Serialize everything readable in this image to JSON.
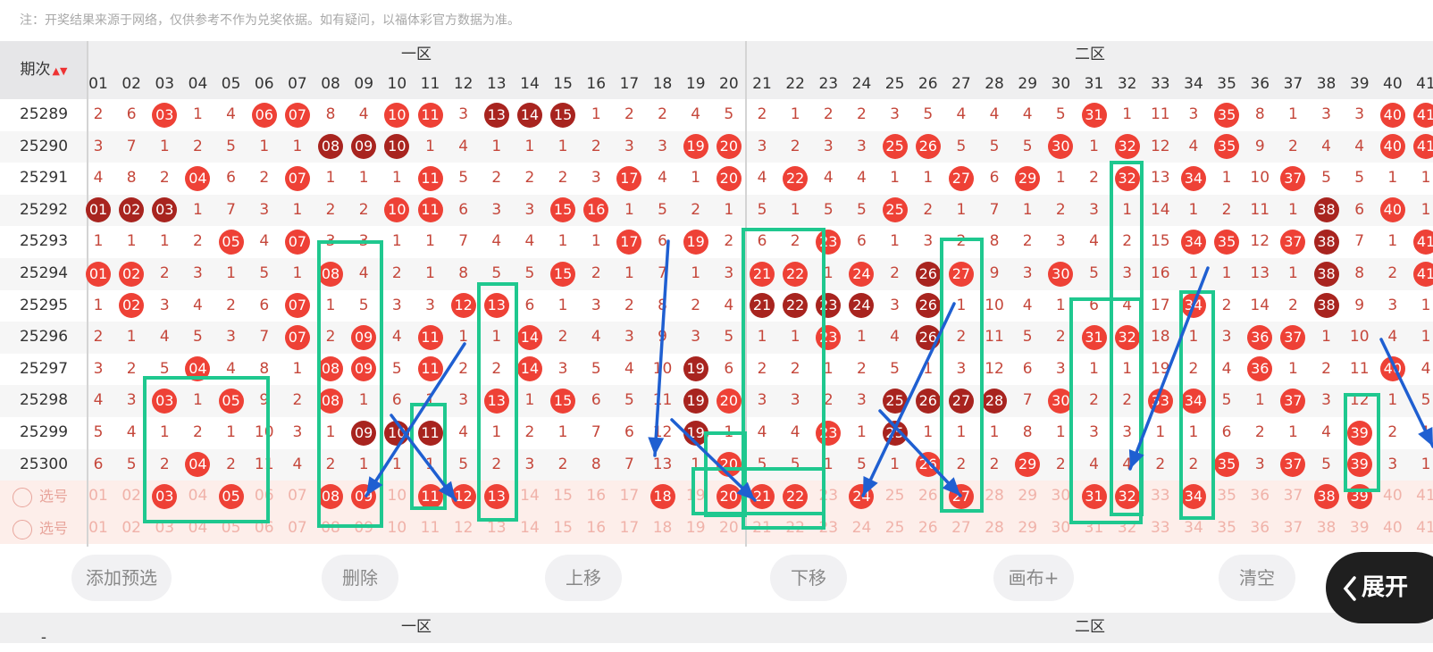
{
  "note": "注：开奖结果来源于网络，仅供参考不作为兑奖依据。如有疑问，以福体彩官方数据为准。",
  "header": {
    "period_label": "期次",
    "zone1_label": "一区",
    "zone2_label": "二区",
    "columns": [
      "01",
      "02",
      "03",
      "04",
      "05",
      "06",
      "07",
      "08",
      "09",
      "10",
      "11",
      "12",
      "13",
      "14",
      "15",
      "16",
      "17",
      "18",
      "19",
      "20",
      "21",
      "22",
      "23",
      "24",
      "25",
      "26",
      "27",
      "28",
      "29",
      "30",
      "31",
      "32",
      "33",
      "34",
      "35",
      "36",
      "37",
      "38",
      "39",
      "40",
      "41"
    ]
  },
  "rows": [
    {
      "period": "25289",
      "cells": [
        "2",
        "6",
        "03",
        "1",
        "4",
        "06",
        "07",
        "8",
        "4",
        "10",
        "11",
        "3",
        "13",
        "14",
        "15",
        "1",
        "2",
        "2",
        "4",
        "5",
        "2",
        "1",
        "2",
        "2",
        "3",
        "5",
        "4",
        "4",
        "4",
        "5",
        "31",
        "1",
        "11",
        "3",
        "35",
        "8",
        "1",
        "3",
        "3",
        "40",
        "41"
      ],
      "red": [
        2,
        5,
        6,
        9,
        10,
        30,
        34,
        39,
        40
      ],
      "dark": [
        12,
        13,
        14
      ]
    },
    {
      "period": "25290",
      "cells": [
        "3",
        "7",
        "1",
        "2",
        "5",
        "1",
        "1",
        "08",
        "09",
        "10",
        "1",
        "4",
        "1",
        "1",
        "1",
        "2",
        "3",
        "3",
        "19",
        "20",
        "3",
        "2",
        "3",
        "3",
        "25",
        "26",
        "5",
        "5",
        "5",
        "30",
        "1",
        "32",
        "12",
        "4",
        "35",
        "9",
        "2",
        "4",
        "4",
        "40",
        "41"
      ],
      "red": [
        18,
        19,
        24,
        25,
        29,
        31,
        34,
        39,
        40
      ],
      "dark": [
        7,
        8,
        9
      ]
    },
    {
      "period": "25291",
      "cells": [
        "4",
        "8",
        "2",
        "04",
        "6",
        "2",
        "07",
        "1",
        "1",
        "1",
        "11",
        "5",
        "2",
        "2",
        "2",
        "3",
        "17",
        "4",
        "1",
        "20",
        "4",
        "22",
        "4",
        "4",
        "1",
        "1",
        "27",
        "6",
        "29",
        "1",
        "2",
        "32",
        "13",
        "34",
        "1",
        "10",
        "37",
        "5",
        "5",
        "1",
        "1"
      ],
      "red": [
        3,
        6,
        10,
        16,
        19,
        21,
        26,
        28,
        31,
        33,
        36
      ],
      "dark": []
    },
    {
      "period": "25292",
      "cells": [
        "01",
        "02",
        "03",
        "1",
        "7",
        "3",
        "1",
        "2",
        "2",
        "10",
        "11",
        "6",
        "3",
        "3",
        "15",
        "16",
        "1",
        "5",
        "2",
        "1",
        "5",
        "1",
        "5",
        "5",
        "25",
        "2",
        "1",
        "7",
        "1",
        "2",
        "3",
        "1",
        "14",
        "1",
        "2",
        "11",
        "1",
        "38",
        "6",
        "40",
        "1"
      ],
      "red": [
        9,
        10,
        14,
        15,
        24,
        39
      ],
      "dark": [
        0,
        1,
        2,
        37
      ]
    },
    {
      "period": "25293",
      "cells": [
        "1",
        "1",
        "1",
        "2",
        "05",
        "4",
        "07",
        "3",
        "3",
        "1",
        "1",
        "7",
        "4",
        "4",
        "1",
        "1",
        "17",
        "6",
        "19",
        "2",
        "6",
        "2",
        "23",
        "6",
        "1",
        "3",
        "2",
        "8",
        "2",
        "3",
        "4",
        "2",
        "15",
        "34",
        "35",
        "12",
        "37",
        "38",
        "7",
        "1",
        "41"
      ],
      "red": [
        4,
        6,
        16,
        18,
        22,
        33,
        34,
        36,
        40
      ],
      "dark": [
        37
      ]
    },
    {
      "period": "25294",
      "cells": [
        "01",
        "02",
        "2",
        "3",
        "1",
        "5",
        "1",
        "08",
        "4",
        "2",
        "1",
        "8",
        "5",
        "5",
        "15",
        "2",
        "1",
        "7",
        "1",
        "3",
        "21",
        "22",
        "1",
        "24",
        "2",
        "26",
        "27",
        "9",
        "3",
        "30",
        "5",
        "3",
        "16",
        "1",
        "1",
        "13",
        "1",
        "38",
        "8",
        "2",
        "41"
      ],
      "red": [
        0,
        1,
        7,
        14,
        20,
        21,
        23,
        26,
        29,
        40
      ],
      "dark": [
        25,
        37
      ]
    },
    {
      "period": "25295",
      "cells": [
        "1",
        "02",
        "3",
        "4",
        "2",
        "6",
        "07",
        "1",
        "5",
        "3",
        "3",
        "12",
        "13",
        "6",
        "1",
        "3",
        "2",
        "8",
        "2",
        "4",
        "21",
        "22",
        "23",
        "24",
        "3",
        "26",
        "1",
        "10",
        "4",
        "1",
        "6",
        "4",
        "17",
        "34",
        "2",
        "14",
        "2",
        "38",
        "9",
        "3",
        "1"
      ],
      "red": [
        1,
        6,
        11,
        12,
        33
      ],
      "dark": [
        20,
        21,
        22,
        23,
        25,
        37
      ]
    },
    {
      "period": "25296",
      "cells": [
        "2",
        "1",
        "4",
        "5",
        "3",
        "7",
        "07",
        "2",
        "09",
        "4",
        "11",
        "1",
        "1",
        "14",
        "2",
        "4",
        "3",
        "9",
        "3",
        "5",
        "1",
        "1",
        "23",
        "1",
        "4",
        "26",
        "2",
        "11",
        "5",
        "2",
        "31",
        "32",
        "18",
        "1",
        "3",
        "36",
        "37",
        "1",
        "10",
        "4",
        "1"
      ],
      "red": [
        6,
        8,
        10,
        13,
        22,
        30,
        31,
        35,
        36
      ],
      "dark": [
        25
      ]
    },
    {
      "period": "25297",
      "cells": [
        "3",
        "2",
        "5",
        "04",
        "4",
        "8",
        "1",
        "08",
        "09",
        "5",
        "11",
        "2",
        "2",
        "14",
        "3",
        "5",
        "4",
        "10",
        "19",
        "6",
        "2",
        "2",
        "1",
        "2",
        "5",
        "1",
        "3",
        "12",
        "6",
        "3",
        "1",
        "1",
        "19",
        "2",
        "4",
        "36",
        "1",
        "2",
        "11",
        "40",
        "4"
      ],
      "red": [
        3,
        7,
        8,
        10,
        13,
        35,
        39
      ],
      "dark": [
        18
      ]
    },
    {
      "period": "25298",
      "cells": [
        "4",
        "3",
        "03",
        "1",
        "05",
        "9",
        "2",
        "08",
        "1",
        "6",
        "1",
        "3",
        "13",
        "1",
        "15",
        "6",
        "5",
        "11",
        "19",
        "20",
        "3",
        "3",
        "2",
        "3",
        "25",
        "26",
        "27",
        "28",
        "7",
        "30",
        "2",
        "2",
        "33",
        "34",
        "5",
        "1",
        "37",
        "3",
        "12",
        "1",
        "5"
      ],
      "red": [
        2,
        4,
        7,
        12,
        14,
        19,
        29,
        32,
        33,
        36
      ],
      "dark": [
        18,
        24,
        25,
        26,
        27
      ]
    },
    {
      "period": "25299",
      "cells": [
        "5",
        "4",
        "1",
        "2",
        "1",
        "10",
        "3",
        "1",
        "09",
        "10",
        "11",
        "4",
        "1",
        "2",
        "1",
        "7",
        "6",
        "12",
        "19",
        "1",
        "4",
        "4",
        "23",
        "1",
        "25",
        "1",
        "1",
        "1",
        "8",
        "1",
        "3",
        "3",
        "1",
        "1",
        "6",
        "2",
        "1",
        "4",
        "39",
        "2",
        "1"
      ],
      "red": [
        22,
        38
      ],
      "dark": [
        8,
        9,
        10,
        18,
        24
      ]
    },
    {
      "period": "25300",
      "cells": [
        "6",
        "5",
        "2",
        "04",
        "2",
        "11",
        "4",
        "2",
        "1",
        "1",
        "1",
        "5",
        "2",
        "3",
        "2",
        "8",
        "7",
        "13",
        "1",
        "20",
        "5",
        "5",
        "1",
        "5",
        "1",
        "26",
        "2",
        "2",
        "29",
        "2",
        "4",
        "4",
        "2",
        "2",
        "35",
        "3",
        "37",
        "5",
        "39",
        "3",
        "1"
      ],
      "red": [
        3,
        19,
        25,
        28,
        34,
        36,
        38
      ],
      "dark": []
    }
  ],
  "selection_rows": [
    {
      "label": "选号",
      "cells": [
        "01",
        "02",
        "03",
        "04",
        "05",
        "06",
        "07",
        "08",
        "09",
        "10",
        "11",
        "12",
        "13",
        "14",
        "15",
        "16",
        "17",
        "18",
        "19",
        "20",
        "21",
        "22",
        "23",
        "24",
        "25",
        "26",
        "27",
        "28",
        "29",
        "30",
        "31",
        "32",
        "33",
        "34",
        "35",
        "36",
        "37",
        "38",
        "39",
        "40",
        "41"
      ],
      "selected": [
        2,
        4,
        7,
        8,
        10,
        11,
        12,
        17,
        19,
        20,
        21,
        23,
        26,
        30,
        31,
        33,
        37,
        38
      ]
    },
    {
      "label": "选号",
      "cells": [
        "01",
        "02",
        "03",
        "04",
        "05",
        "06",
        "07",
        "08",
        "09",
        "10",
        "11",
        "12",
        "13",
        "14",
        "15",
        "16",
        "17",
        "18",
        "19",
        "20",
        "21",
        "22",
        "23",
        "24",
        "25",
        "26",
        "27",
        "28",
        "29",
        "30",
        "31",
        "32",
        "33",
        "34",
        "35",
        "36",
        "37",
        "38",
        "39",
        "40",
        "41"
      ],
      "selected": []
    }
  ],
  "buttons": {
    "add": "添加预选",
    "delete": "删除",
    "move_up": "上移",
    "move_down": "下移",
    "canvas": "画布+",
    "clear": "清空",
    "expand": "展开"
  },
  "footer": {
    "left": "-",
    "zone1_label": "一区",
    "zone2_label": "二区"
  },
  "colors": {
    "red_ball": "#ee4136",
    "dark_ball": "#a8241f",
    "annotation_green": "#1fc88f",
    "annotation_blue": "#1f5fd1"
  }
}
